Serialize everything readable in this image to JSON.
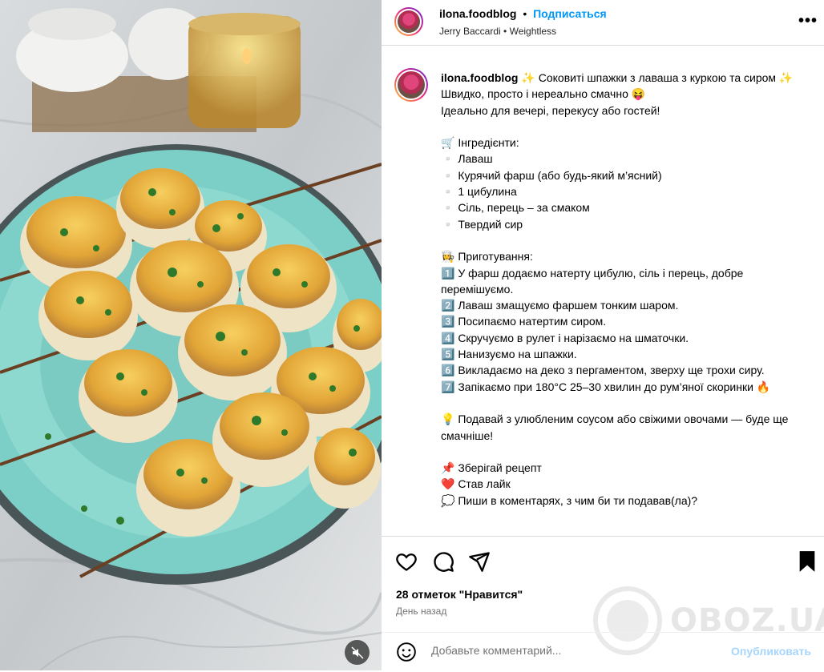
{
  "post": {
    "username": "ilona.foodblog",
    "follow_label": "Подписаться",
    "dot": "•",
    "audio_artist": "Jerry Baccardi",
    "audio_track": "Weightless",
    "more_icon": "more-dots-icon",
    "caption_text": "✨ Соковиті шпажки з лаваша з куркою та сиром ✨\nШвидко, просто і нереально смачно 😝\nІдеально для вечері, перекусу або гостей!\n\n🛒 Інгредієнти:\n▫️ Лаваш\n▫️ Курячий фарш (або будь-який м’ясний)\n▫️ 1 цибулина\n▫️ Сіль, перець – за смаком\n▫️ Твердий сир\n\n👩‍🍳 Приготування:\n1️⃣ У фарш додаємо натерту цибулю, сіль і перець, добре перемішуємо.\n2️⃣ Лаваш змащуємо фаршем тонким шаром.\n3️⃣ Посипаємо натертим сиром.\n4️⃣ Скручуємо в рулет і нарізаємо на шматочки.\n5️⃣ Нанизуємо на шпажки.\n6️⃣ Викладаємо на деко з пергаментом, зверху ще трохи сиру.\n7️⃣ Запікаємо при 180°C 25–30 хвилин до рум’яної скоринки 🔥\n\n💡 Подавай з улюбленим соусом або свіжими овочами — буде ще смачніше!\n\n📌 Зберігай рецепт\n❤️ Став лайк\n💭 Пиши в коментарях, з чим би ти подавав(ла)?"
  },
  "actions": {
    "likes_text": "28 отметок \"Нравится\"",
    "time_text": "День назад",
    "comment_placeholder": "Добавьте комментарий...",
    "publish_label": "Опубликовать",
    "icons": [
      "heart-icon",
      "comment-icon",
      "share-icon",
      "bookmark-icon",
      "emoji-icon",
      "mute-icon"
    ]
  },
  "watermark": {
    "text": "OBOZ.UA"
  },
  "colors": {
    "accent": "#0095f6",
    "publish_disabled": "#a8d5fb",
    "plate": "#7ccfc6",
    "cheese": "#e8b43c"
  }
}
